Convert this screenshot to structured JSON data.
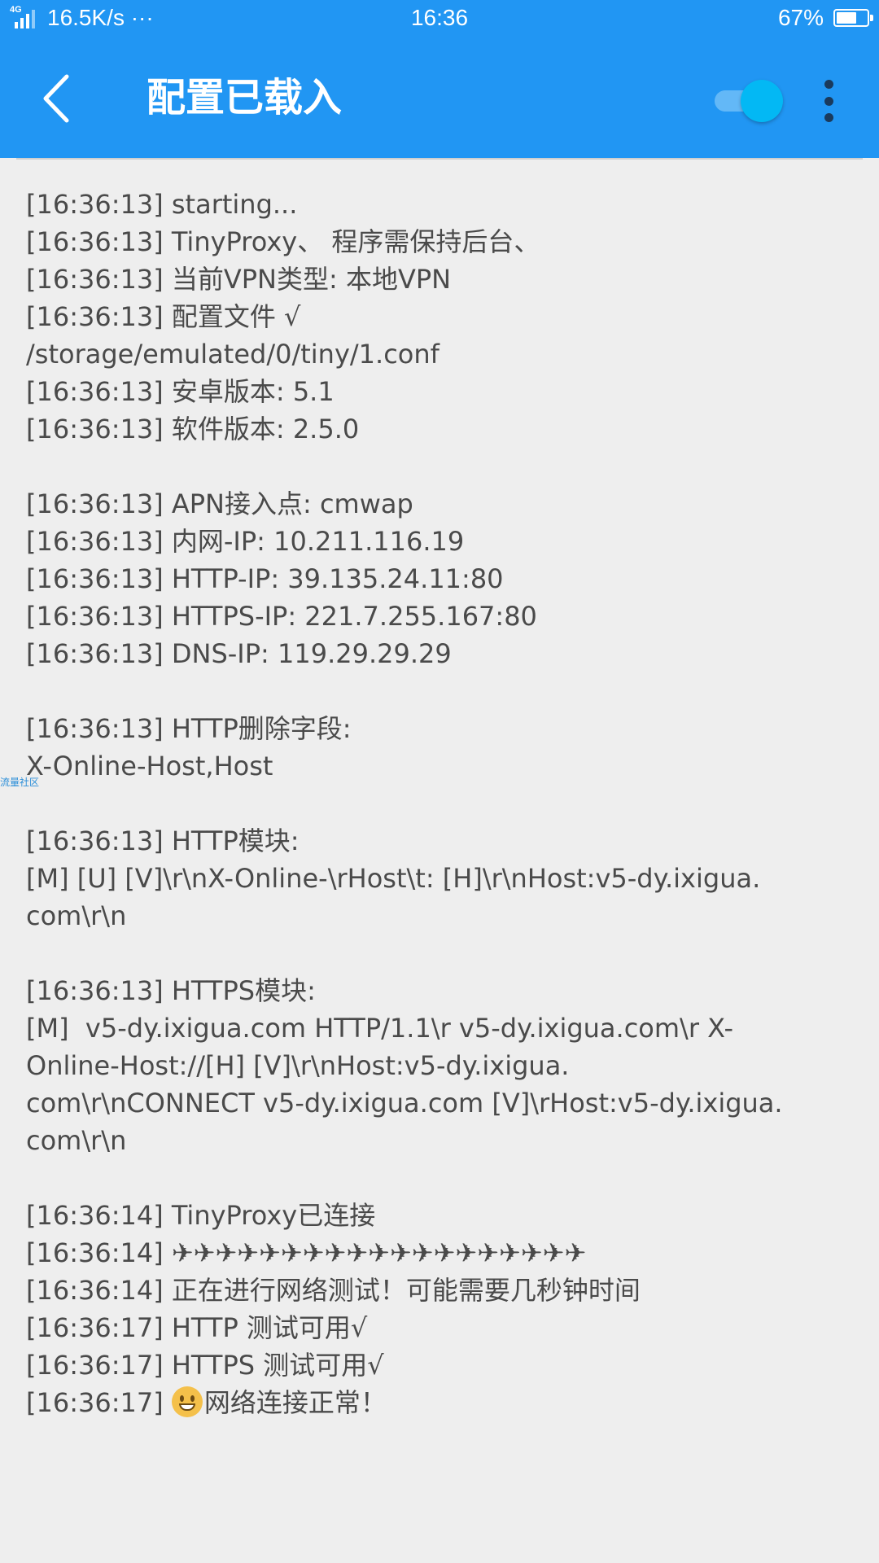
{
  "status_bar": {
    "network_tag": "4G",
    "speed": "16.5K/s ···",
    "time": "16:36",
    "battery_percent": "67%",
    "battery_level": 0.67
  },
  "app_bar": {
    "title": "配置已载入",
    "back_icon": "back-arrow-icon",
    "more_icon": "more-vert-icon",
    "toggle_on": true,
    "color": "#2196f3"
  },
  "log_lines": [
    "[16:36:13] starting...",
    "[16:36:13] TinyProxy、 程序需保持后台、",
    "[16:36:13] 当前VPN类型: 本地VPN",
    "[16:36:13] 配置文件 √",
    "/storage/emulated/0/tiny/1.conf",
    "[16:36:13] 安卓版本: 5.1",
    "[16:36:13] 软件版本: 2.5.0",
    "",
    "[16:36:13] APN接入点: cmwap",
    "[16:36:13] 内网-IP: 10.211.116.19",
    "[16:36:13] HTTP-IP: 39.135.24.11:80",
    "[16:36:13] HTTPS-IP: 221.7.255.167:80",
    "[16:36:13] DNS-IP: 119.29.29.29",
    "",
    "[16:36:13] HTTP删除字段:",
    "X-Online-Host,Host",
    "",
    "[16:36:13] HTTP模块:",
    "[M] [U] [V]\\r\\nX-Online-\\rHost\\t: [H]\\r\\nHost:v5-dy.ixigua.",
    "com\\r\\n",
    "",
    "[16:36:13] HTTPS模块:",
    "[M]  v5-dy.ixigua.com HTTP/1.1\\r v5-dy.ixigua.com\\r X-",
    "Online-Host://[H] [V]\\r\\nHost:v5-dy.ixigua.",
    "com\\r\\nCONNECT v5-dy.ixigua.com [V]\\rHost:v5-dy.ixigua.",
    "com\\r\\n",
    "",
    "[16:36:14] TinyProxy已连接",
    "[16:36:14] ✈✈✈✈✈✈✈✈✈✈✈✈✈✈✈✈✈✈✈",
    "[16:36:14] 正在进行网络测试！可能需要几秒钟时间",
    "[16:36:17] HTTP 测试可用√",
    "[16:36:17] HTTPS 测试可用√"
  ],
  "final_line": {
    "prefix": "[16:36:17] ",
    "icon": "smiley-emoji-icon",
    "text": "网络连接正常！"
  },
  "watermark": "流量社区"
}
